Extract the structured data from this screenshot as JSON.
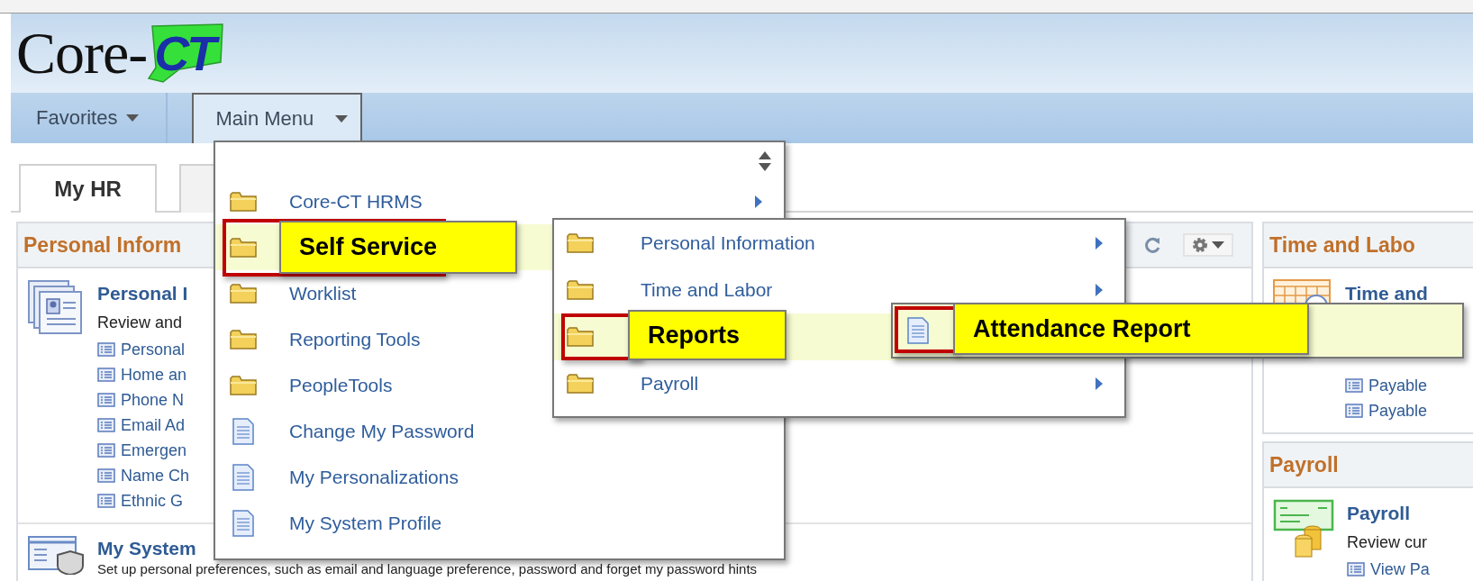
{
  "logo": {
    "text": "Core-",
    "badge": "CT"
  },
  "nav": [
    {
      "label": "Favorites",
      "selected": false
    },
    {
      "label": "Main Menu",
      "selected": true
    }
  ],
  "tabs": [
    {
      "label": "My HR",
      "selected": true
    },
    {
      "selected": false
    }
  ],
  "main_menu": {
    "items": [
      {
        "label": "Core-CT HRMS",
        "kind": "folder",
        "selected": false,
        "has_submenu": true
      },
      {
        "label": "Self Service",
        "kind": "folder",
        "selected": true,
        "has_submenu": false
      },
      {
        "label": "Worklist",
        "kind": "folder",
        "selected": false,
        "has_submenu": false
      },
      {
        "label": "Reporting Tools",
        "kind": "folder",
        "selected": false,
        "has_submenu": false
      },
      {
        "label": "PeopleTools",
        "kind": "folder",
        "selected": false,
        "has_submenu": false
      },
      {
        "label": "Change My Password",
        "kind": "page",
        "selected": false,
        "has_submenu": false
      },
      {
        "label": "My Personalizations",
        "kind": "page",
        "selected": false,
        "has_submenu": false
      },
      {
        "label": "My System Profile",
        "kind": "page",
        "selected": false,
        "has_submenu": false
      }
    ]
  },
  "submenu": {
    "items": [
      {
        "label": "Personal Information",
        "kind": "folder",
        "selected": false,
        "has_submenu": true
      },
      {
        "label": "Time and Labor",
        "kind": "folder",
        "selected": false,
        "has_submenu": true
      },
      {
        "label": "Reports",
        "kind": "folder",
        "selected": true,
        "has_submenu": false
      },
      {
        "label": "Payroll",
        "kind": "folder",
        "selected": false,
        "has_submenu": true
      }
    ]
  },
  "subsubmenu": {
    "items": [
      {
        "label": "Attendance Report",
        "kind": "page",
        "selected": true,
        "has_submenu": false
      }
    ]
  },
  "left_panel": {
    "title": "Personal Inform",
    "sections": [
      {
        "kind": "profile",
        "title": "Personal I",
        "description": "Review and",
        "links": [
          "Personal",
          "Home an",
          "Phone N",
          "Email Ad",
          "Emergen",
          "Name Ch",
          "Ethnic G"
        ]
      },
      {
        "kind": "preferences",
        "title": "My System",
        "description": "Set up personal preferences, such as email and language preference, password and forget my password hints"
      }
    ]
  },
  "right_panels": [
    {
      "title": "Time and Labo",
      "sections": [
        {
          "kind": "calendar",
          "title": "Time and",
          "links": [
            "Payable",
            "Payable"
          ]
        }
      ]
    },
    {
      "title": "Payroll",
      "sections": [
        {
          "kind": "payroll",
          "title": "Payroll",
          "description": "Review cur",
          "links": [
            "View Pa"
          ]
        }
      ]
    }
  ]
}
